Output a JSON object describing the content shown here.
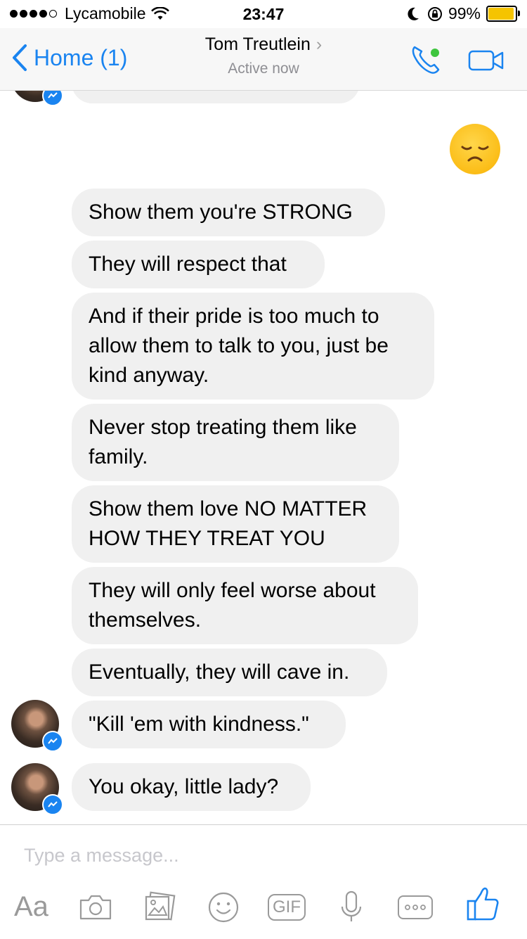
{
  "status_bar": {
    "carrier": "Lycamobile",
    "time": "23:47",
    "battery": "99%",
    "battery_level": 0.99
  },
  "nav": {
    "back_label": "Home (1)",
    "contact_name": "Tom Treutlein",
    "contact_status": "Active now",
    "phone_icon": "phone-icon",
    "video_icon": "video-camera-icon",
    "colors": {
      "accent": "#1a84f0",
      "active": "#3ec53e"
    }
  },
  "conversation": {
    "sent_emoji": "disappointed-face-emoji",
    "messages": [
      {
        "sender": "them",
        "text": "Show them you're STRONG"
      },
      {
        "sender": "them",
        "text": "They will respect that"
      },
      {
        "sender": "them",
        "text": "And if their pride is too much to allow them to talk to you, just be kind anyway."
      },
      {
        "sender": "them",
        "text": "Never stop treating them like family."
      },
      {
        "sender": "them",
        "text": "Show them love NO MATTER HOW THEY TREAT YOU"
      },
      {
        "sender": "them",
        "text": "They will only feel worse about themselves."
      },
      {
        "sender": "them",
        "text": "Eventually, they will cave in."
      },
      {
        "sender": "them",
        "text": "\"Kill 'em with kindness.\""
      },
      {
        "sender": "them",
        "text": "You okay, little lady?"
      }
    ]
  },
  "composer": {
    "placeholder": "Type a message...",
    "aa_label": "Aa",
    "gif_label": "GIF",
    "icons": [
      "text-format-icon",
      "camera-icon",
      "photo-icon",
      "emoji-icon",
      "gif-icon",
      "microphone-icon",
      "more-icon",
      "thumbs-up-icon"
    ]
  }
}
